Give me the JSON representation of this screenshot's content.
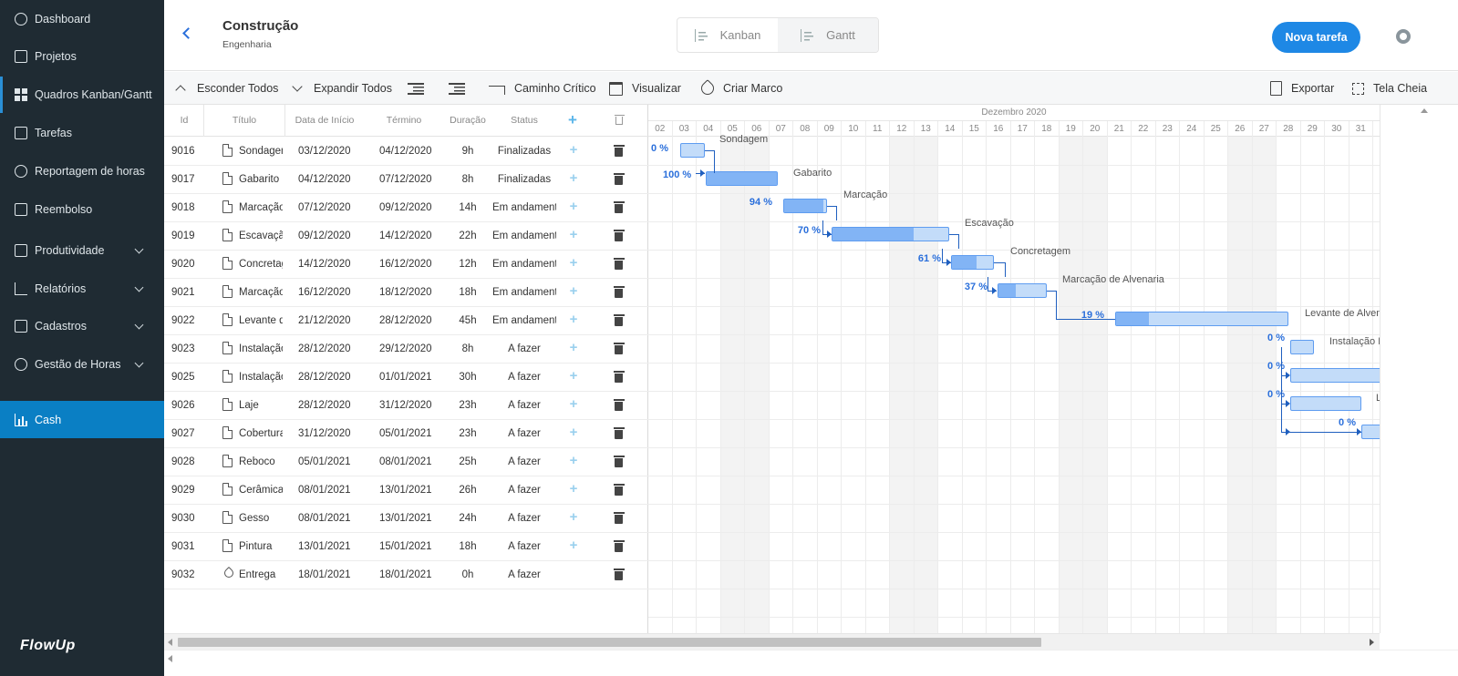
{
  "sidebar": {
    "items": [
      {
        "label": "Dashboard",
        "icon": "dashboard-icon"
      },
      {
        "label": "Projetos",
        "icon": "book-icon"
      },
      {
        "label": "Quadros Kanban/Gantt",
        "icon": "grid-icon"
      },
      {
        "label": "Tarefas",
        "icon": "list-icon"
      },
      {
        "label": "Reportagem de horas",
        "icon": "clock-icon"
      },
      {
        "label": "Reembolso",
        "icon": "receipt-icon"
      },
      {
        "label": "Produtividade",
        "icon": "book-icon"
      },
      {
        "label": "Relatórios",
        "icon": "line-chart-icon"
      },
      {
        "label": "Cadastros",
        "icon": "id-card-icon"
      },
      {
        "label": "Gestão de Horas",
        "icon": "history-icon"
      },
      {
        "label": "Cash",
        "icon": "bar-chart-icon"
      }
    ],
    "logo": "FlowUp"
  },
  "header": {
    "title": "Construção",
    "subtitle": "Engenharia",
    "views": [
      "Kanban",
      "Gantt"
    ],
    "selected_view": "Gantt",
    "new_task": "Nova tarefa"
  },
  "toolbar": {
    "hide_all": "Esconder Todos",
    "expand_all": "Expandir Todos",
    "critical_path": "Caminho Crítico",
    "view": "Visualizar",
    "create_milestone": "Criar Marco",
    "export": "Exportar",
    "fullscreen": "Tela Cheia"
  },
  "grid": {
    "columns": [
      "Id",
      "Título",
      "Data de Início",
      "Término",
      "Duração",
      "Status"
    ],
    "rows": [
      {
        "id": "9016",
        "title": "Sondagem",
        "start": "03/12/2020",
        "end": "04/12/2020",
        "duration": "9h",
        "status": "Finalizadas"
      },
      {
        "id": "9017",
        "title": "Gabarito",
        "start": "04/12/2020",
        "end": "07/12/2020",
        "duration": "8h",
        "status": "Finalizadas"
      },
      {
        "id": "9018",
        "title": "Marcação",
        "start": "07/12/2020",
        "end": "09/12/2020",
        "duration": "14h",
        "status": "Em andamento"
      },
      {
        "id": "9019",
        "title": "Escavação",
        "start": "09/12/2020",
        "end": "14/12/2020",
        "duration": "22h",
        "status": "Em andamento"
      },
      {
        "id": "9020",
        "title": "Concretagem",
        "start": "14/12/2020",
        "end": "16/12/2020",
        "duration": "12h",
        "status": "Em andamento"
      },
      {
        "id": "9021",
        "title": "Marcação de Alvenaria",
        "start": "16/12/2020",
        "end": "18/12/2020",
        "duration": "18h",
        "status": "Em andamento"
      },
      {
        "id": "9022",
        "title": "Levante de Alvenaria",
        "start": "21/12/2020",
        "end": "28/12/2020",
        "duration": "45h",
        "status": "Em andamento"
      },
      {
        "id": "9023",
        "title": "Instalação Elétrica",
        "start": "28/12/2020",
        "end": "29/12/2020",
        "duration": "8h",
        "status": "A fazer"
      },
      {
        "id": "9025",
        "title": "Instalação Hidráulica",
        "start": "28/12/2020",
        "end": "01/01/2021",
        "duration": "30h",
        "status": "A fazer"
      },
      {
        "id": "9026",
        "title": "Laje",
        "start": "28/12/2020",
        "end": "31/12/2020",
        "duration": "23h",
        "status": "A fazer"
      },
      {
        "id": "9027",
        "title": "Cobertura",
        "start": "31/12/2020",
        "end": "05/01/2021",
        "duration": "23h",
        "status": "A fazer"
      },
      {
        "id": "9028",
        "title": "Reboco",
        "start": "05/01/2021",
        "end": "08/01/2021",
        "duration": "25h",
        "status": "A fazer"
      },
      {
        "id": "9029",
        "title": "Cerâmica",
        "start": "08/01/2021",
        "end": "13/01/2021",
        "duration": "26h",
        "status": "A fazer"
      },
      {
        "id": "9030",
        "title": "Gesso",
        "start": "08/01/2021",
        "end": "13/01/2021",
        "duration": "24h",
        "status": "A fazer"
      },
      {
        "id": "9031",
        "title": "Pintura",
        "start": "13/01/2021",
        "end": "15/01/2021",
        "duration": "18h",
        "status": "A fazer"
      },
      {
        "id": "9032",
        "title": "Entrega",
        "start": "18/01/2021",
        "end": "18/01/2021",
        "duration": "0h",
        "status": "A fazer",
        "milestone": true
      }
    ]
  },
  "gantt": {
    "month": "Dezembro 2020",
    "days": [
      "02",
      "03",
      "04",
      "05",
      "06",
      "07",
      "08",
      "09",
      "10",
      "11",
      "12",
      "13",
      "14",
      "15",
      "16",
      "17",
      "18",
      "19",
      "20",
      "21",
      "22",
      "23",
      "24",
      "25",
      "26",
      "27",
      "28",
      "29",
      "30",
      "31"
    ],
    "weekend_days": [
      "05",
      "06",
      "12",
      "13",
      "19",
      "20",
      "26",
      "27"
    ],
    "bars": [
      {
        "label": "Sondagem",
        "progress": "0 %",
        "progress_value": 0
      },
      {
        "label": "Gabarito",
        "progress": "100 %",
        "progress_value": 100
      },
      {
        "label": "Marcação",
        "progress": "94 %",
        "progress_value": 94
      },
      {
        "label": "Escavação",
        "progress": "70 %",
        "progress_value": 70
      },
      {
        "label": "Concretagem",
        "progress": "61 %",
        "progress_value": 61
      },
      {
        "label": "Marcação de Alvenaria",
        "progress": "37 %",
        "progress_value": 37
      },
      {
        "label": "Levante de Alvenaria",
        "progress": "19 %",
        "progress_value": 19
      },
      {
        "label": "Instalação Elétrica",
        "progress": "0 %",
        "progress_value": 0
      },
      {
        "label": "",
        "progress": "0 %",
        "progress_value": 0
      },
      {
        "label": "Laje",
        "progress": "0 %",
        "progress_value": 0
      },
      {
        "label": "",
        "progress": "0 %",
        "progress_value": 0
      }
    ]
  },
  "colors": {
    "sidebar_bg": "#1f2b33",
    "sidebar_active": "#0a7fc4",
    "primary": "#1e88e5",
    "bar_fill": "#c3dcf9",
    "bar_progress": "#82b4f5",
    "link": "#1f5fbf"
  }
}
